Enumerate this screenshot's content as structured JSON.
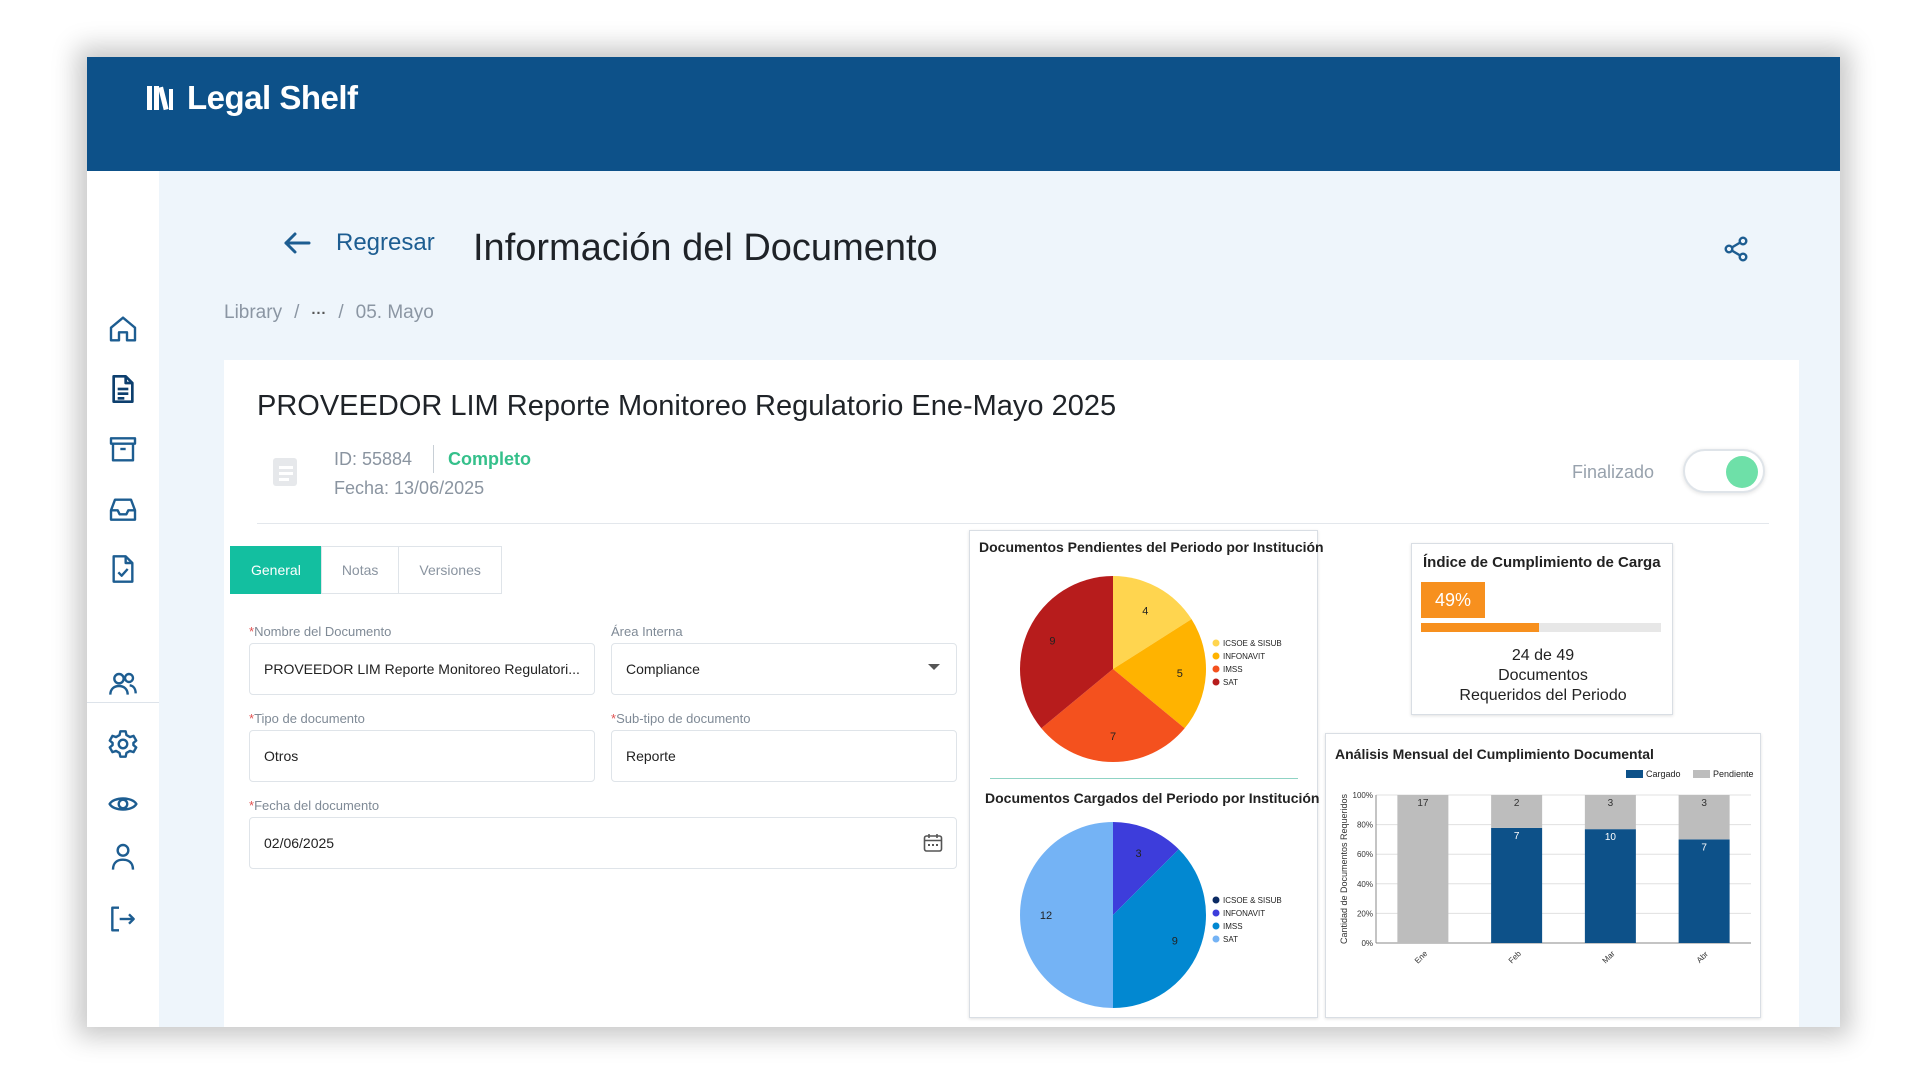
{
  "app": {
    "name": "Legal Shelf"
  },
  "header": {
    "back_label": "Regresar",
    "title": "Información del Documento"
  },
  "breadcrumb": {
    "items": [
      "Library",
      "/",
      "···",
      "/",
      "05. Mayo"
    ]
  },
  "document": {
    "title": "PROVEEDOR LIM Reporte Monitoreo Regulatorio Ene-Mayo 2025",
    "id_text": "ID: 55884",
    "status": "Completo",
    "date_text": "Fecha: 13/06/2025",
    "finalized_label": "Finalizado",
    "finalized": true
  },
  "tabs": [
    {
      "label": "General",
      "active": true
    },
    {
      "label": "Notas",
      "active": false
    },
    {
      "label": "Versiones",
      "active": false
    }
  ],
  "form": {
    "name": {
      "label": "Nombre del Documento",
      "required": true,
      "value": "PROVEEDOR LIM Reporte Monitoreo Regulatori..."
    },
    "area": {
      "label": "Área Interna",
      "required": false,
      "value": "Compliance"
    },
    "type": {
      "label": "Tipo de documento",
      "required": true,
      "value": "Otros"
    },
    "subtype": {
      "label": "Sub-tipo de documento",
      "required": true,
      "value": "Reporte"
    },
    "date": {
      "label": "Fecha del documento",
      "required": true,
      "value": "02/06/2025"
    }
  },
  "colors": {
    "brand": "#0d5189",
    "accent": "#13bfa0",
    "status_ok": "#35c08b",
    "progress": "#f7901e"
  },
  "icons": {
    "sidebar": [
      "home-icon",
      "document-icon",
      "archive-icon",
      "inbox-icon",
      "document-check-icon",
      "users-icon",
      "gear-icon",
      "eye-icon",
      "user-icon",
      "logout-icon"
    ]
  },
  "kpi": {
    "title": "Índice de Cumplimiento de Carga",
    "percent_label": "49%",
    "progress": 0.49,
    "count_loaded": "24",
    "count_sep": "de",
    "count_total": "49",
    "caption_line1": "Documentos",
    "caption_line2": "Requeridos del Periodo"
  },
  "chart_data": [
    {
      "type": "pie",
      "title": "Documentos Pendientes del Periodo por Institución",
      "legend": "right",
      "slices": [
        {
          "label": "ICSOE & SISUB",
          "value": 4,
          "color": "#ffd54f"
        },
        {
          "label": "INFONAVIT",
          "value": 5,
          "color": "#ffb300"
        },
        {
          "label": "IMSS",
          "value": 7,
          "color": "#f4511e"
        },
        {
          "label": "SAT",
          "value": 9,
          "color": "#b71c1c"
        }
      ]
    },
    {
      "type": "pie",
      "title": "Documentos Cargados del Periodo por Institución",
      "legend": "right",
      "slices": [
        {
          "label": "ICSOE & SISUB",
          "value": 0,
          "color": "#0b2a63"
        },
        {
          "label": "INFONAVIT",
          "value": 3,
          "color": "#3d3ddb"
        },
        {
          "label": "IMSS",
          "value": 9,
          "color": "#0288d1"
        },
        {
          "label": "SAT",
          "value": 12,
          "color": "#74b3f5"
        }
      ]
    },
    {
      "type": "bar",
      "stacked": true,
      "percent": true,
      "title": "Análisis Mensual del Cumplimiento Documental",
      "ylabel": "Cantidad de Documentos Requeridos",
      "yticks": [
        "0%",
        "20%",
        "40%",
        "60%",
        "80%",
        "100%"
      ],
      "legend": "top-right",
      "categories": [
        "Ene",
        "Feb",
        "Mar",
        "Abr"
      ],
      "series": [
        {
          "name": "Cargado",
          "values": [
            0,
            7,
            10,
            7
          ],
          "color": "#0d5189"
        },
        {
          "name": "Pendiente",
          "values": [
            17,
            2,
            3,
            3
          ],
          "color": "#bdbdbd"
        }
      ]
    }
  ]
}
